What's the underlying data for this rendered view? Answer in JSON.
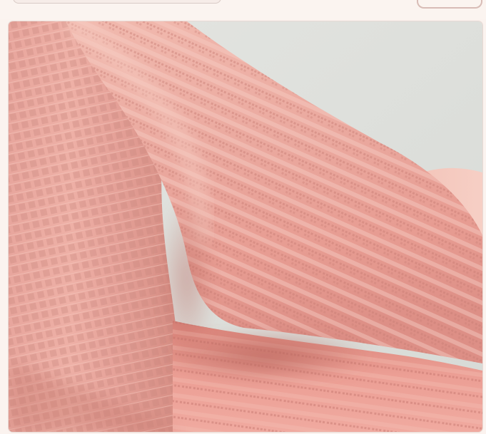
{
  "image": {
    "alt": "",
    "colors": {
      "fabric_base": "#e9a59c",
      "fabric_light": "#f2bdb3",
      "fabric_shadow": "#c9786f",
      "background_wall": "#dfe2df",
      "page_background": "#fbf3ef"
    }
  }
}
